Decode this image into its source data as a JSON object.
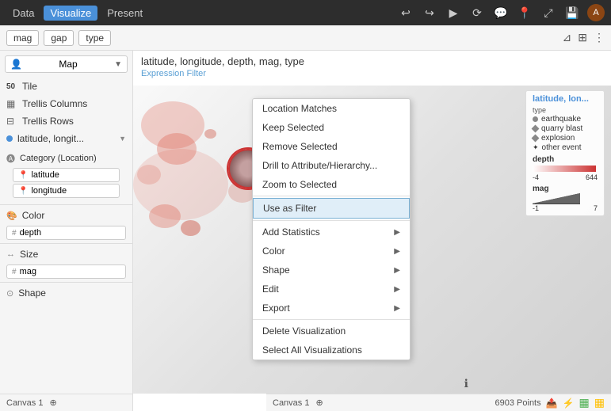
{
  "topbar": {
    "nav": [
      {
        "label": "Data",
        "active": false
      },
      {
        "label": "Visualize",
        "active": true
      },
      {
        "label": "Present",
        "active": false
      }
    ],
    "avatar": "A"
  },
  "filters": {
    "tags": [
      "mag",
      "gap",
      "type"
    ],
    "filter_icon": "⊿",
    "layout_icon": "⊞"
  },
  "sidebar": {
    "map_select_label": "Map",
    "map_icon": "👤",
    "tile_label": "Tile",
    "tile_value": "50",
    "trellis_columns_label": "Trellis Columns",
    "trellis_rows_label": "Trellis Rows",
    "fields_label": "latitude, longit...",
    "category_label": "Category (Location)",
    "latitude_label": "latitude",
    "longitude_label": "longitude",
    "color_label": "Color",
    "color_field": "depth",
    "size_label": "Size",
    "size_field": "mag",
    "shape_label": "Shape"
  },
  "content": {
    "title": "latitude, longitude, depth, mag, type",
    "expression_filter": "Expression Filter"
  },
  "context_menu": {
    "items": [
      {
        "label": "Location Matches",
        "has_arrow": false
      },
      {
        "label": "Keep Selected",
        "has_arrow": false
      },
      {
        "label": "Remove Selected",
        "has_arrow": false
      },
      {
        "label": "Drill to Attribute/Hierarchy...",
        "has_arrow": false
      },
      {
        "label": "Zoom to Selected",
        "has_arrow": false
      },
      {
        "label": "Use as Filter",
        "has_arrow": false,
        "highlighted": true
      },
      {
        "label": "Add Statistics",
        "has_arrow": true
      },
      {
        "label": "Color",
        "has_arrow": true
      },
      {
        "label": "Shape",
        "has_arrow": true
      },
      {
        "label": "Edit",
        "has_arrow": true
      },
      {
        "label": "Export",
        "has_arrow": true
      },
      {
        "label": "Delete Visualization",
        "has_arrow": false
      },
      {
        "label": "Select All Visualizations",
        "has_arrow": false
      }
    ]
  },
  "legend": {
    "title": "latitude, lon...",
    "type_label": "type",
    "items": [
      {
        "label": "earthquake",
        "color": "#888"
      },
      {
        "label": "quarry blast",
        "color": "#aaa",
        "shape": "diamond"
      },
      {
        "label": "explosion",
        "color": "#bbb",
        "shape": "diamond"
      },
      {
        "label": "other event",
        "color": "#ccc",
        "shape": "star"
      }
    ],
    "depth_label": "depth",
    "depth_min": "-4",
    "depth_max": "644",
    "mag_label": "mag",
    "mag_min": "-1",
    "mag_max": "7"
  },
  "statusbar": {
    "canvas_label": "Canvas 1",
    "points_label": "6903 Points"
  }
}
